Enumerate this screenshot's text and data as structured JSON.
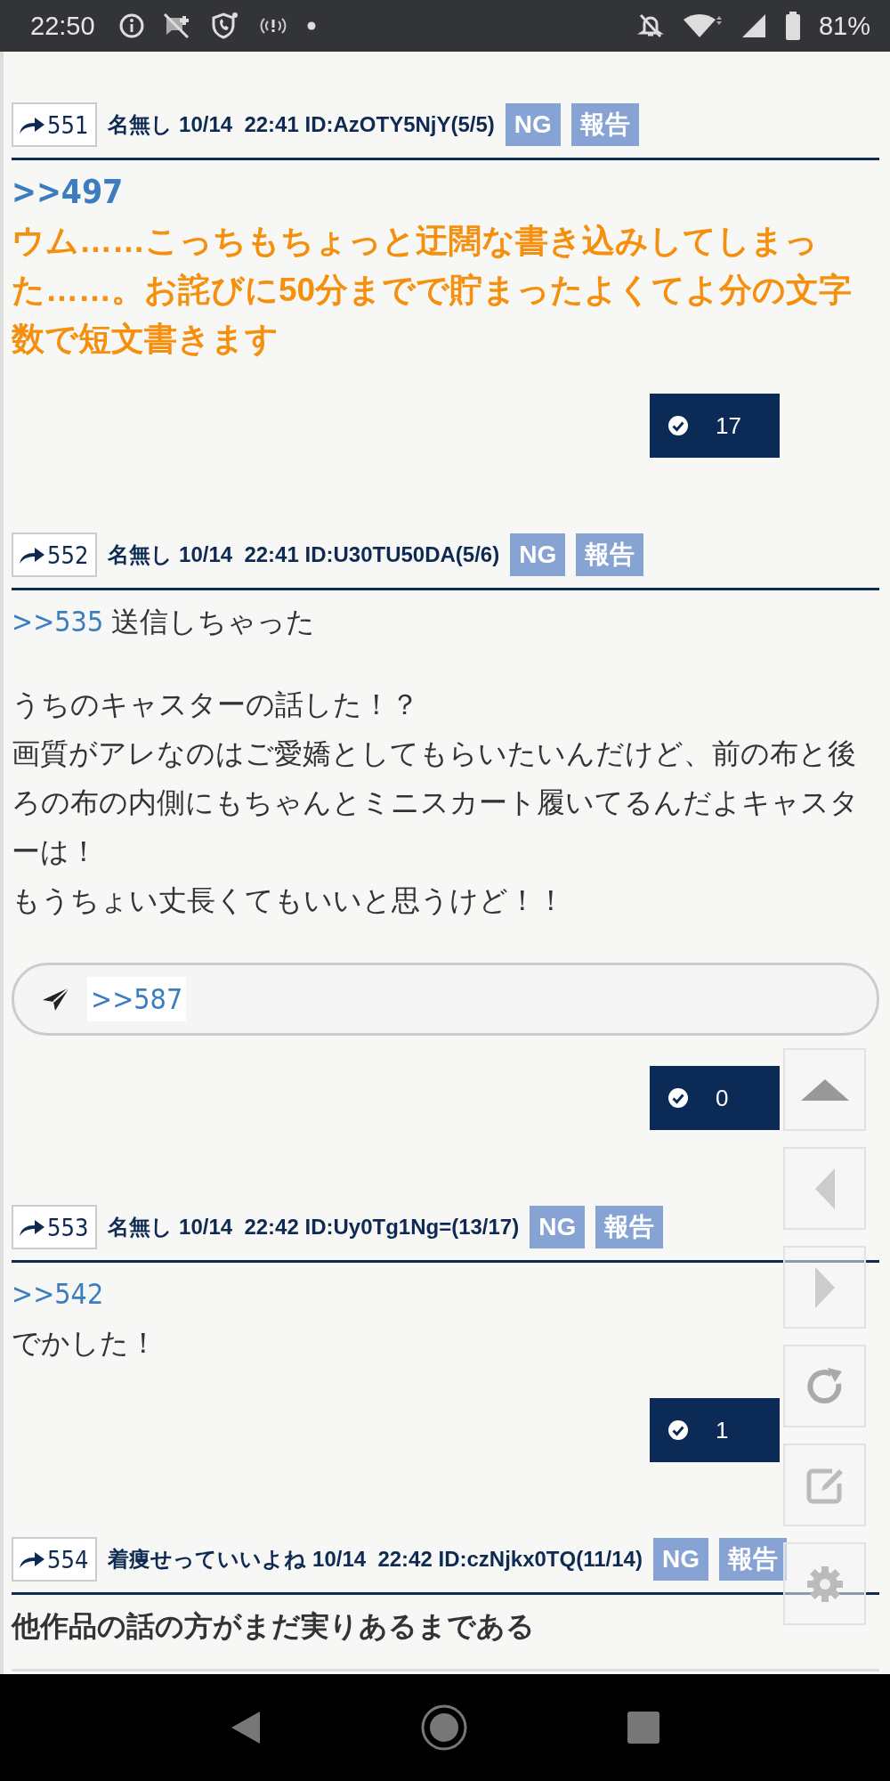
{
  "status_bar": {
    "time": "22:50",
    "battery": "81%"
  },
  "posts": [
    {
      "number": "551",
      "name": "名無し",
      "date": "10/14",
      "time": "22:41",
      "id": "ID:AzOTY5NjY(5/5)",
      "ng": "NG",
      "report": "報告",
      "kind": "highlight",
      "blocks": [
        [
          {
            "anchor": ">>497"
          },
          {
            "text": "ウム……こっちもちょっと迂闊な書き込みしてしまった……。お詫びに50分までで貯まったよくてよ分の文字数で短文書きます"
          }
        ]
      ],
      "likes": "17"
    },
    {
      "number": "552",
      "name": "名無し",
      "date": "10/14",
      "time": "22:41",
      "id": "ID:U30TU50DA(5/6)",
      "ng": "NG",
      "report": "報告",
      "kind": "plain",
      "blocks": [
        [
          {
            "anchor": ">>535",
            "text": "送信しちゃった"
          }
        ],
        [
          {
            "text": "うちのキャスターの話した！？"
          },
          {
            "text": "画質がアレなのはご愛嬌としてもらいたいんだけど、前の布と後ろの布の内側にもちゃんとミニスカート履いてるんだよキャスターは！"
          },
          {
            "text": "もうちょい丈長くてもいいと思うけど！！"
          }
        ]
      ],
      "reply_field": {
        "value": ">>587"
      },
      "likes": "0"
    },
    {
      "number": "553",
      "name": "名無し",
      "date": "10/14",
      "time": "22:42",
      "id": "ID:Uy0Tg1Ng=(13/17)",
      "ng": "NG",
      "report": "報告",
      "kind": "plain",
      "blocks": [
        [
          {
            "anchor": ">>542"
          },
          {
            "text": "でかした！"
          }
        ]
      ],
      "likes": "1"
    },
    {
      "number": "554",
      "name": "着痩せっていいよね",
      "date": "10/14",
      "time": "22:42",
      "id": "ID:czNjkx0TQ(11/14)",
      "ng": "NG",
      "report": "報告",
      "kind": "bold",
      "blocks": [
        [
          {
            "text": "他作品の話の方がまだ実りあるまである"
          }
        ]
      ]
    }
  ]
}
